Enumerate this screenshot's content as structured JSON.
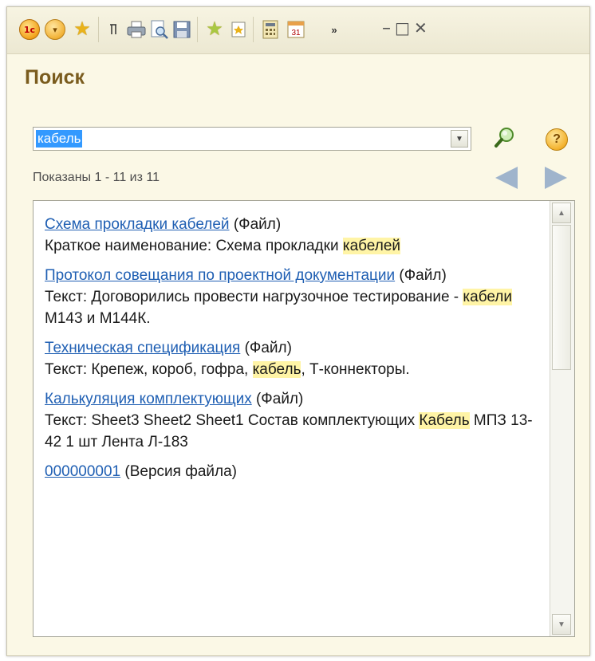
{
  "window": {
    "title": "Поиск",
    "toolbar_icons": [
      "1c-logo-icon",
      "main-menu-icon",
      "favorites-star-icon",
      "text-cursor-icon",
      "print-icon",
      "print-preview-icon",
      "save-icon",
      "add-favorite-icon",
      "bookmark-icon",
      "calculator-icon",
      "calendar-icon",
      "overflow-icon"
    ],
    "logo_text": "1c",
    "calendar_text": "31",
    "controls": {
      "minimize": "–",
      "maximize": "□",
      "close": "✕"
    }
  },
  "search": {
    "query": "кабель",
    "help_label": "?"
  },
  "results_summary": "Показаны 1 - 11 из 11",
  "results": [
    {
      "link": "Схема прокладки кабелей",
      "type": " (Файл)",
      "pre": "Краткое наименование: Схема прокладки ",
      "hl": "кабелей",
      "post": ""
    },
    {
      "link": "Протокол совещания по проектной документации",
      "type": " (Файл)",
      "pre": "Текст: Договорились провести нагрузочное тестирование - ",
      "hl": "кабели",
      "post": " М143 и М144К."
    },
    {
      "link": "Техническая спецификация",
      "type": " (Файл)",
      "pre": "Текст: Крепеж, короб, гофра, ",
      "hl": "кабель",
      "post": ", Т-коннекторы."
    },
    {
      "link": "Калькуляция комплектующих",
      "type": " (Файл)",
      "pre": "Текст: Sheet3 Sheet2 Sheet1 Состав комплектующих ",
      "hl": "Кабель",
      "post": " МПЗ 13-42 1 шт Лента Л-183"
    },
    {
      "link": "000000001",
      "type": " (Версия файла)",
      "pre": "",
      "hl": "",
      "post": ""
    }
  ],
  "colors": {
    "link": "#1f5fb3",
    "highlight": "#fff4a6",
    "title": "#7a5c1e",
    "window_bg": "#fbf8e6"
  }
}
